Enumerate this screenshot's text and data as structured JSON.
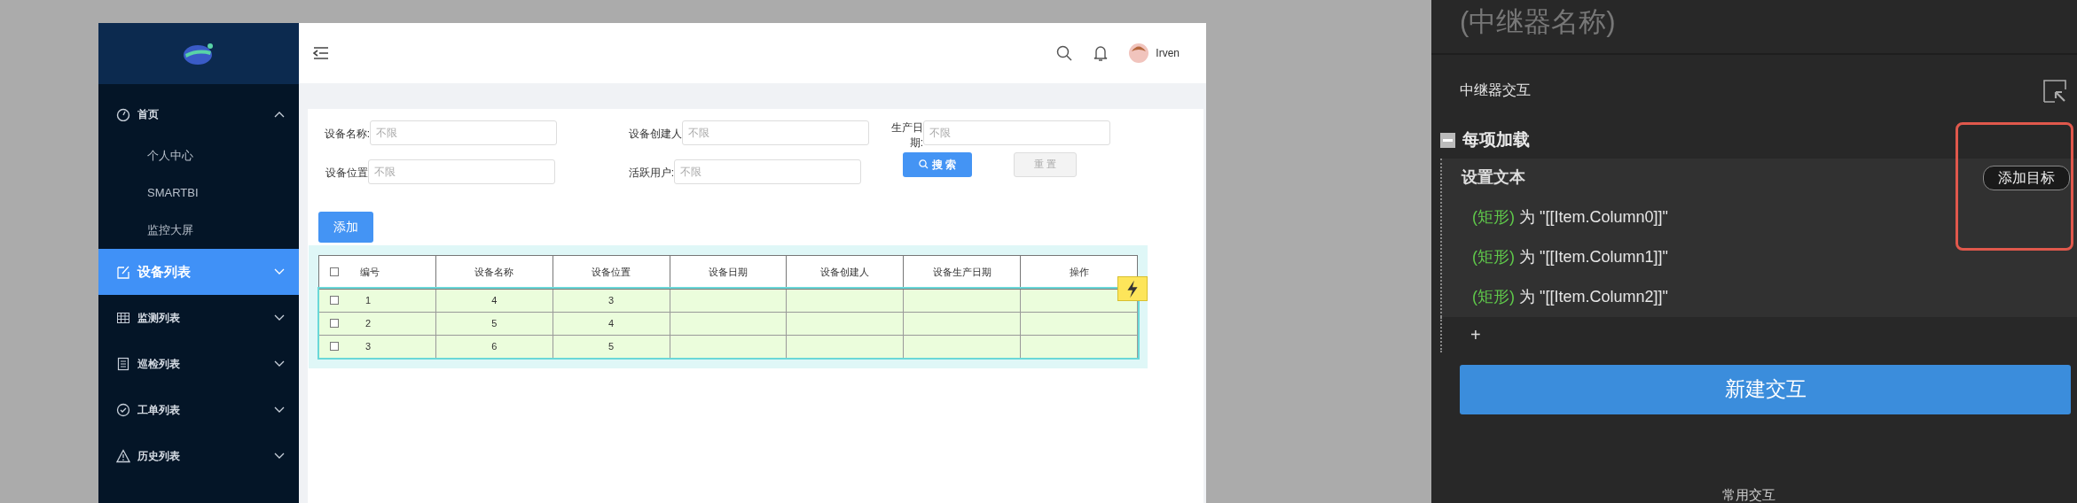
{
  "sidebar": {
    "items": [
      {
        "label": "首页",
        "expanded": true,
        "selected": false,
        "children": [
          {
            "label": "个人中心"
          },
          {
            "label": "SMARTBI"
          },
          {
            "label": "监控大屏"
          }
        ]
      },
      {
        "label": "设备列表",
        "expanded": false,
        "selected": true
      },
      {
        "label": "监测列表",
        "expanded": false,
        "selected": false
      },
      {
        "label": "巡检列表",
        "expanded": false,
        "selected": false
      },
      {
        "label": "工单列表",
        "expanded": false,
        "selected": false
      },
      {
        "label": "历史列表",
        "expanded": false,
        "selected": false
      }
    ]
  },
  "header": {
    "user": "Irven"
  },
  "filters": [
    {
      "label": "设备名称:",
      "placeholder": "不限"
    },
    {
      "label": "设备创建人",
      "placeholder": "不限"
    },
    {
      "label": "生产日期:",
      "placeholder": "不限"
    },
    {
      "label": "设备位置",
      "placeholder": "不限"
    },
    {
      "label": "活跃用户:",
      "placeholder": "不限"
    }
  ],
  "search_button": {
    "label": "搜 索"
  },
  "reset_button": {
    "label": "重 置",
    "disabled": true
  },
  "add_button": {
    "label": "添加"
  },
  "table": {
    "all_checked": false,
    "columns": [
      "编号",
      "设备名称",
      "设备位置",
      "设备日期",
      "设备创建人",
      "设备生产日期",
      "操作"
    ],
    "rows": [
      {
        "checked": false,
        "cells": [
          "1",
          "4",
          "3"
        ]
      },
      {
        "checked": false,
        "cells": [
          "2",
          "5",
          "4"
        ]
      },
      {
        "checked": false,
        "cells": [
          "3",
          "6",
          "5"
        ]
      }
    ]
  },
  "panel": {
    "title": "(中继器名称)",
    "section": "中继器交互",
    "event": {
      "label": "每项加载",
      "expanded": true,
      "actions": [
        {
          "label": "设置文本",
          "add_target": "添加目标",
          "items": [
            {
              "target": "(矩形)",
              "text": "为 \"[[Item.Column0]]\""
            },
            {
              "target": "(矩形)",
              "text": "为 \"[[Item.Column1]]\""
            },
            {
              "target": "(矩形)",
              "text": "为 \"[[Item.Column2]]\""
            }
          ]
        }
      ],
      "add": "+"
    },
    "new_button": "新建交互",
    "footer": "常用交互"
  }
}
